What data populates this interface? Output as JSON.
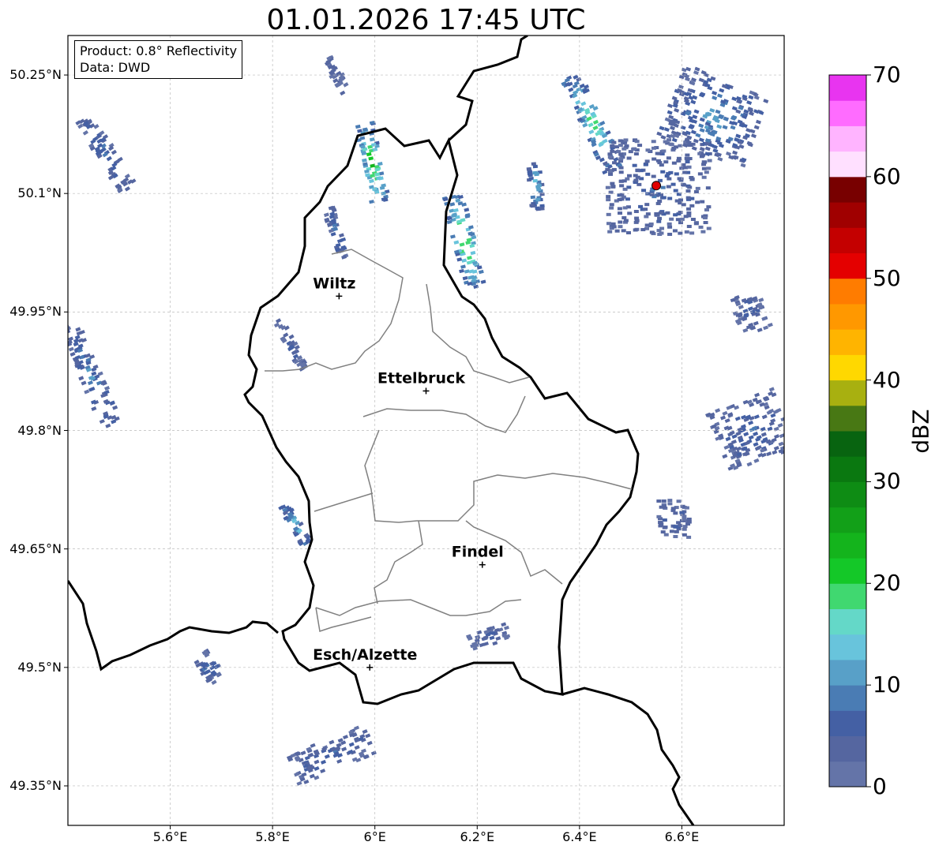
{
  "title": "01.01.2026 17:45 UTC",
  "info": {
    "product": "Product: 0.8° Reflectivity",
    "data": "Data: DWD"
  },
  "map": {
    "lon_range": [
      5.4,
      6.8
    ],
    "lat_range": [
      49.3,
      50.3
    ],
    "lon_ticks": [
      {
        "value": 5.6,
        "label": "5.6°E"
      },
      {
        "value": 5.8,
        "label": "5.8°E"
      },
      {
        "value": 6.0,
        "label": "6°E"
      },
      {
        "value": 6.2,
        "label": "6.2°E"
      },
      {
        "value": 6.4,
        "label": "6.4°E"
      },
      {
        "value": 6.6,
        "label": "6.6°E"
      }
    ],
    "lat_ticks": [
      {
        "value": 50.25,
        "label": "50.25°N"
      },
      {
        "value": 50.1,
        "label": "50.1°N"
      },
      {
        "value": 49.95,
        "label": "49.95°N"
      },
      {
        "value": 49.8,
        "label": "49.8°N"
      },
      {
        "value": 49.65,
        "label": "49.65°N"
      },
      {
        "value": 49.5,
        "label": "49.5°N"
      },
      {
        "value": 49.35,
        "label": "49.35°N"
      }
    ],
    "cities": [
      {
        "name": "Wiltz",
        "lon": 5.93,
        "lat": 49.97
      },
      {
        "name": "Ettelbruck",
        "lon": 6.1,
        "lat": 49.85
      },
      {
        "name": "Findel",
        "lon": 6.21,
        "lat": 49.63
      },
      {
        "name": "Esch/Alzette",
        "lon": 5.99,
        "lat": 49.5
      }
    ],
    "radar_site": {
      "lon": 6.55,
      "lat": 50.11,
      "color": "#e00000"
    }
  },
  "colorbar": {
    "label": "dBZ",
    "min": 0,
    "max": 70,
    "ticks": [
      {
        "value": 0,
        "label": "0"
      },
      {
        "value": 10,
        "label": "10"
      },
      {
        "value": 20,
        "label": "20"
      },
      {
        "value": 30,
        "label": "30"
      },
      {
        "value": 40,
        "label": "40"
      },
      {
        "value": 50,
        "label": "50"
      },
      {
        "value": 60,
        "label": "60"
      },
      {
        "value": 70,
        "label": "70"
      }
    ],
    "colors": [
      "#6474a8",
      "#5566a0",
      "#4460a4",
      "#4a7cb4",
      "#58a0c8",
      "#68c4dc",
      "#64d8c8",
      "#40d870",
      "#14c828",
      "#14b41c",
      "#12a018",
      "#0e8c14",
      "#0a7810",
      "#086410",
      "#487814",
      "#a8b010",
      "#ffd800",
      "#ffb400",
      "#ff9800",
      "#ff7c00",
      "#e40000",
      "#c40000",
      "#a00000",
      "#780000",
      "#ffe0ff",
      "#ffb4ff",
      "#ff6cff",
      "#e834f0"
    ]
  },
  "echoes": [
    {
      "lon": 5.47,
      "lat": 50.15,
      "w": 0.035,
      "h": 0.11,
      "rot": -32,
      "dbz": 7
    },
    {
      "lon": 5.44,
      "lat": 49.87,
      "w": 0.04,
      "h": 0.14,
      "rot": -22,
      "dbz": 9
    },
    {
      "lon": 5.99,
      "lat": 50.14,
      "w": 0.035,
      "h": 0.1,
      "rot": -12,
      "dbz": 21
    },
    {
      "lon": 5.92,
      "lat": 50.05,
      "w": 0.02,
      "h": 0.07,
      "rot": -18,
      "dbz": 8
    },
    {
      "lon": 6.17,
      "lat": 50.04,
      "w": 0.04,
      "h": 0.12,
      "rot": -14,
      "dbz": 20
    },
    {
      "lon": 6.31,
      "lat": 50.11,
      "w": 0.025,
      "h": 0.06,
      "rot": -5,
      "dbz": 13
    },
    {
      "lon": 6.42,
      "lat": 50.19,
      "w": 0.04,
      "h": 0.13,
      "rot": -25,
      "dbz": 17
    },
    {
      "lon": 6.55,
      "lat": 50.11,
      "w": 0.2,
      "h": 0.12,
      "rot": 0,
      "dbz": 6
    },
    {
      "lon": 6.66,
      "lat": 50.2,
      "w": 0.18,
      "h": 0.1,
      "rot": 20,
      "dbz": 9
    },
    {
      "lon": 6.73,
      "lat": 49.8,
      "w": 0.14,
      "h": 0.08,
      "rot": -22,
      "dbz": 6
    },
    {
      "lon": 6.58,
      "lat": 49.69,
      "w": 0.06,
      "h": 0.05,
      "rot": 0,
      "dbz": 5
    },
    {
      "lon": 5.84,
      "lat": 49.68,
      "w": 0.02,
      "h": 0.06,
      "rot": -30,
      "dbz": 12
    },
    {
      "lon": 5.91,
      "lat": 49.39,
      "w": 0.16,
      "h": 0.04,
      "rot": -22,
      "dbz": 6
    },
    {
      "lon": 5.67,
      "lat": 49.5,
      "w": 0.035,
      "h": 0.04,
      "rot": -30,
      "dbz": 7
    },
    {
      "lon": 5.83,
      "lat": 49.91,
      "w": 0.02,
      "h": 0.07,
      "rot": -30,
      "dbz": 5
    },
    {
      "lon": 6.73,
      "lat": 49.95,
      "w": 0.06,
      "h": 0.05,
      "rot": -20,
      "dbz": 5
    },
    {
      "lon": 6.22,
      "lat": 49.54,
      "w": 0.08,
      "h": 0.02,
      "rot": -18,
      "dbz": 5
    },
    {
      "lon": 5.92,
      "lat": 50.25,
      "w": 0.02,
      "h": 0.05,
      "rot": -30,
      "dbz": 4
    }
  ]
}
